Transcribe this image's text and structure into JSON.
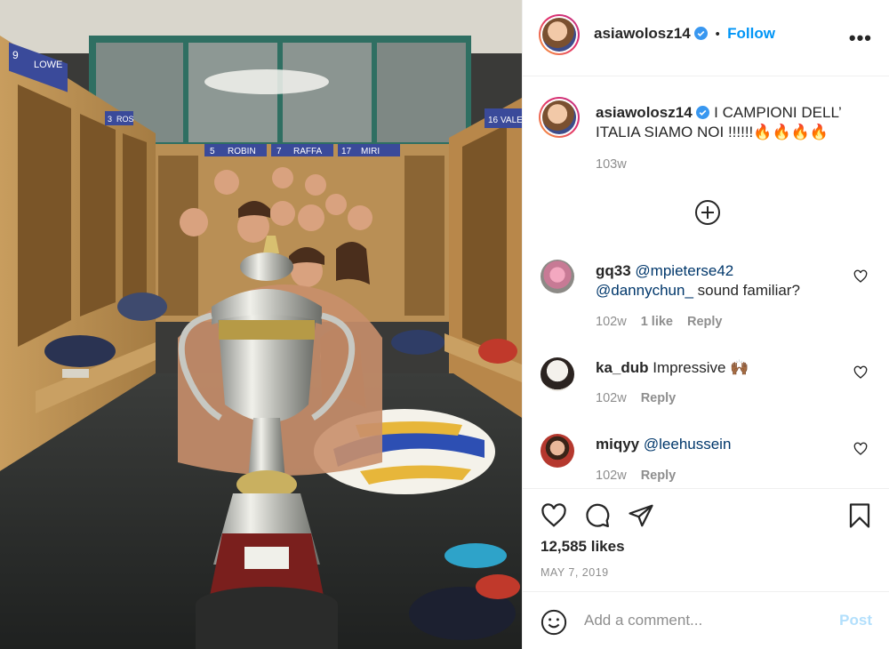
{
  "post": {
    "username": "asiawolosz14",
    "follow_label": "Follow",
    "more_label": "•••",
    "separator": "•",
    "caption_line1": "I CAMPIONI DELL’",
    "caption_line2": "ITALIA SIAMO NOI !!!!!!🔥🔥🔥🔥",
    "caption_age": "103w",
    "likes": "12,585 likes",
    "date": "MAY 7, 2019",
    "add_comment_placeholder": "Add a comment...",
    "post_label": "Post"
  },
  "photo": {
    "locker_labels": [
      "9",
      "LOWE",
      "5",
      "ROBIN",
      "7",
      "RAFFA",
      "17",
      "MIRI",
      "16",
      "VALE",
      "3",
      "ROS"
    ]
  },
  "comments": [
    {
      "user": "gq33",
      "mention1": "@mpieterse42",
      "mention2": "@dannychun_",
      "text": " sound familiar?",
      "age": "102w",
      "likes": "1 like",
      "reply": "Reply"
    },
    {
      "user": "ka_dub",
      "text": "Impressive 🙌🏾",
      "age": "102w",
      "reply": "Reply"
    },
    {
      "user": "miqyy",
      "mention1": "@leehussein",
      "age": "102w",
      "reply": "Reply"
    }
  ],
  "colors": {
    "accent": "#0095f6",
    "text": "#262626",
    "muted": "#8e8e8e",
    "mention": "#00376b",
    "post_disabled": "#b2dffc"
  },
  "icons": [
    "verified-badge-icon",
    "expand-plus-icon",
    "heart-icon",
    "comment-icon",
    "share-icon",
    "bookmark-icon",
    "emoji-icon"
  ]
}
